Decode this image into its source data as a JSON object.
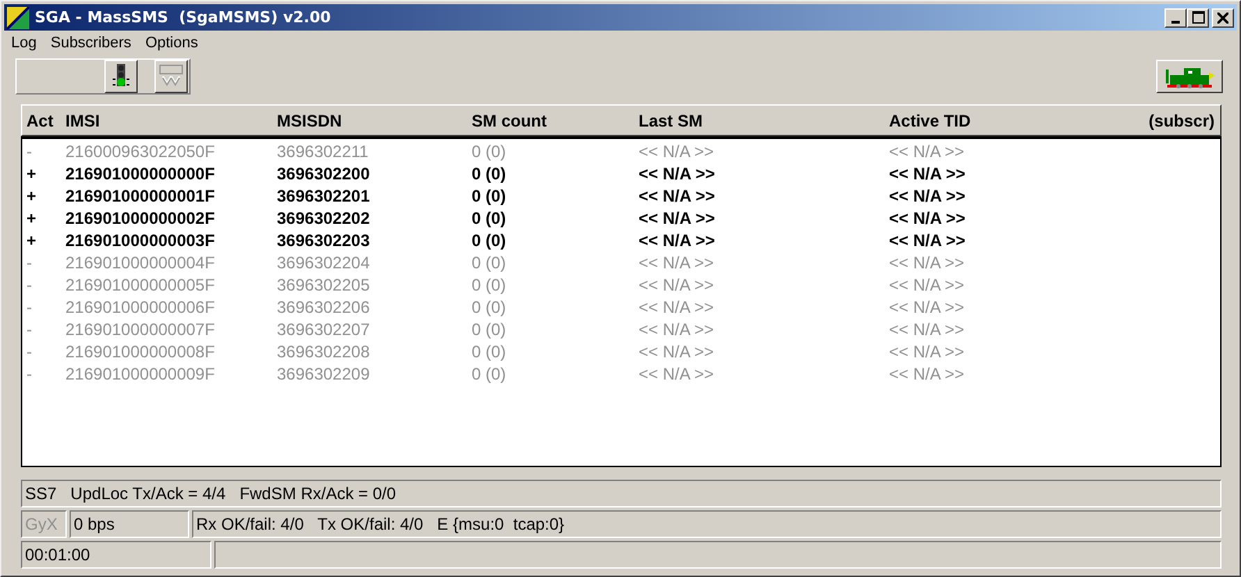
{
  "window": {
    "title": "SGA - MassSMS  (SgaMSMS) v2.00"
  },
  "menu": [
    "Log",
    "Subscribers",
    "Options"
  ],
  "table": {
    "columns": [
      "Act",
      "IMSI",
      "MSISDN",
      "SM count",
      "Last SM",
      "Active TID",
      "(subscr)"
    ],
    "rows": [
      {
        "act": "-",
        "imsi": "216000963022050F",
        "msisdn": "3696302211",
        "sm_count": "0 (0)",
        "last_sm": "<< N/A >>",
        "active_tid": "<< N/A >>",
        "active": false
      },
      {
        "act": "+",
        "imsi": "216901000000000F",
        "msisdn": "3696302200",
        "sm_count": "0 (0)",
        "last_sm": "<< N/A >>",
        "active_tid": "<< N/A >>",
        "active": true
      },
      {
        "act": "+",
        "imsi": "216901000000001F",
        "msisdn": "3696302201",
        "sm_count": "0 (0)",
        "last_sm": "<< N/A >>",
        "active_tid": "<< N/A >>",
        "active": true
      },
      {
        "act": "+",
        "imsi": "216901000000002F",
        "msisdn": "3696302202",
        "sm_count": "0 (0)",
        "last_sm": "<< N/A >>",
        "active_tid": "<< N/A >>",
        "active": true
      },
      {
        "act": "+",
        "imsi": "216901000000003F",
        "msisdn": "3696302203",
        "sm_count": "0 (0)",
        "last_sm": "<< N/A >>",
        "active_tid": "<< N/A >>",
        "active": true
      },
      {
        "act": "-",
        "imsi": "216901000000004F",
        "msisdn": "3696302204",
        "sm_count": "0 (0)",
        "last_sm": "<< N/A >>",
        "active_tid": "<< N/A >>",
        "active": false
      },
      {
        "act": "-",
        "imsi": "216901000000005F",
        "msisdn": "3696302205",
        "sm_count": "0 (0)",
        "last_sm": "<< N/A >>",
        "active_tid": "<< N/A >>",
        "active": false
      },
      {
        "act": "-",
        "imsi": "216901000000006F",
        "msisdn": "3696302206",
        "sm_count": "0 (0)",
        "last_sm": "<< N/A >>",
        "active_tid": "<< N/A >>",
        "active": false
      },
      {
        "act": "-",
        "imsi": "216901000000007F",
        "msisdn": "3696302207",
        "sm_count": "0 (0)",
        "last_sm": "<< N/A >>",
        "active_tid": "<< N/A >>",
        "active": false
      },
      {
        "act": "-",
        "imsi": "216901000000008F",
        "msisdn": "3696302208",
        "sm_count": "0 (0)",
        "last_sm": "<< N/A >>",
        "active_tid": "<< N/A >>",
        "active": false
      },
      {
        "act": "-",
        "imsi": "216901000000009F",
        "msisdn": "3696302209",
        "sm_count": "0 (0)",
        "last_sm": "<< N/A >>",
        "active_tid": "<< N/A >>",
        "active": false
      }
    ]
  },
  "status": {
    "ss7": "SS7   UpdLoc Tx/Ack = 4/4   FwdSM Rx/Ack = 0/0",
    "gyx": {
      "label": "GyX",
      "disabled": true
    },
    "bps": "0 bps",
    "rxtx": "Rx OK/fail: 4/0   Tx OK/fail: 4/0   E {msu:0  tcap:0}",
    "time": "00:01:00"
  }
}
